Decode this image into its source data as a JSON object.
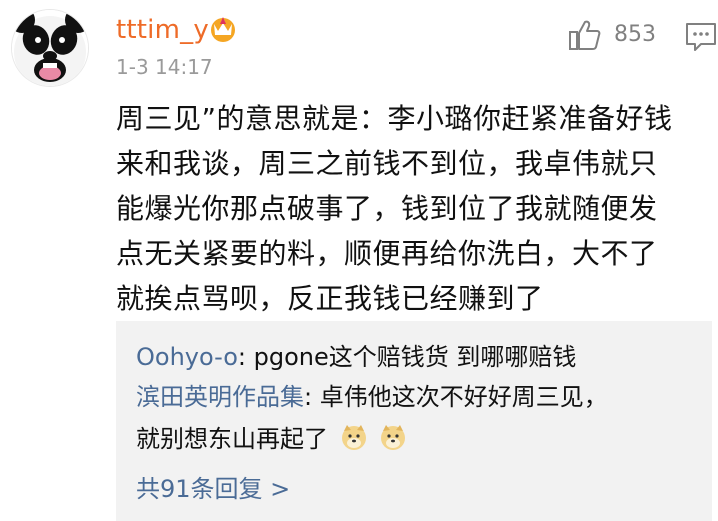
{
  "comment": {
    "username": "tttim_y",
    "badge_icon": "crown-icon",
    "timestamp": "1-3 14:17",
    "likes": "853",
    "like_icon": "thumbs-up-icon",
    "reply_icon": "comment-icon",
    "text": "周三见”的意思就是：李小璐你赶紧准备好钱\n来和我谈，周三之前钱不到位，我卓伟就只\n能爆光你那点破事了，钱到位了我就随便发\n点无关紧要的料，顺便再给你洗白，大不了\n就挨点骂呗，反正我钱已经赚到了"
  },
  "replies": [
    {
      "author": "Oohyo-o",
      "separator": ": ",
      "text": "pgone这个赔钱货 到哪哪赔钱"
    },
    {
      "author": "滨田英明作品集",
      "separator": ": ",
      "text": "卓伟他这次不好好周三见，",
      "continuation": "就别想东山再起了",
      "emojis": [
        "doge-emoji",
        "doge-emoji"
      ]
    }
  ],
  "more_replies_label": "共91条回复 >",
  "colors": {
    "username": "#ee6b28",
    "reply_author": "#4a6b96",
    "timestamp": "#9a9a9a",
    "replies_background": "#f2f2f2"
  }
}
